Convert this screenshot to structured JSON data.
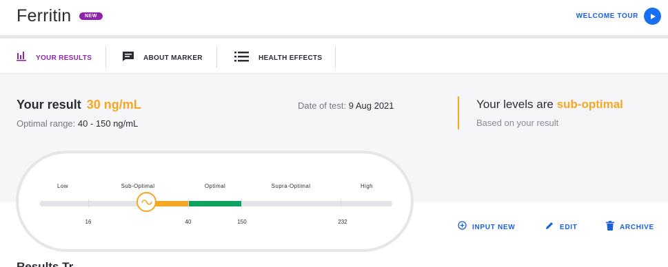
{
  "header": {
    "title": "Ferritin",
    "badge": "NEW",
    "tour_label": "WELCOME TOUR"
  },
  "tabs": [
    {
      "label": "YOUR RESULTS",
      "icon": "bar-chart-icon",
      "active": true
    },
    {
      "label": "ABOUT MARKER",
      "icon": "comment-icon",
      "active": false
    },
    {
      "label": "HEALTH EFFECTS",
      "icon": "list-icon",
      "active": false
    }
  ],
  "result": {
    "label": "Your result",
    "value": "30 ng/mL",
    "range_label": "Optimal range:",
    "range_value": "40 - 150 ng/mL",
    "date_label": "Date of test:",
    "date_value": "9 Aug 2021"
  },
  "levels": {
    "prefix": "Your levels are",
    "status": "sub-optimal",
    "subtitle": "Based on your result"
  },
  "gauge": {
    "categories": [
      "Low",
      "Sub-Optimal",
      "Optimal",
      "Supra-Optimal",
      "High"
    ],
    "thresholds": [
      "16",
      "40",
      "150",
      "232"
    ],
    "current_value": 30
  },
  "actions": [
    {
      "label": "INPUT NEW",
      "icon": "plus-circle-icon"
    },
    {
      "label": "EDIT",
      "icon": "pencil-icon"
    },
    {
      "label": "ARCHIVE",
      "icon": "trash-icon"
    }
  ],
  "bottom_heading": "Results Tr",
  "colors": {
    "accent": "#8e24aa",
    "link": "#1a5fe0",
    "warning": "#f5a623",
    "optimal": "#0da35e",
    "track": "#e3e3e8"
  }
}
